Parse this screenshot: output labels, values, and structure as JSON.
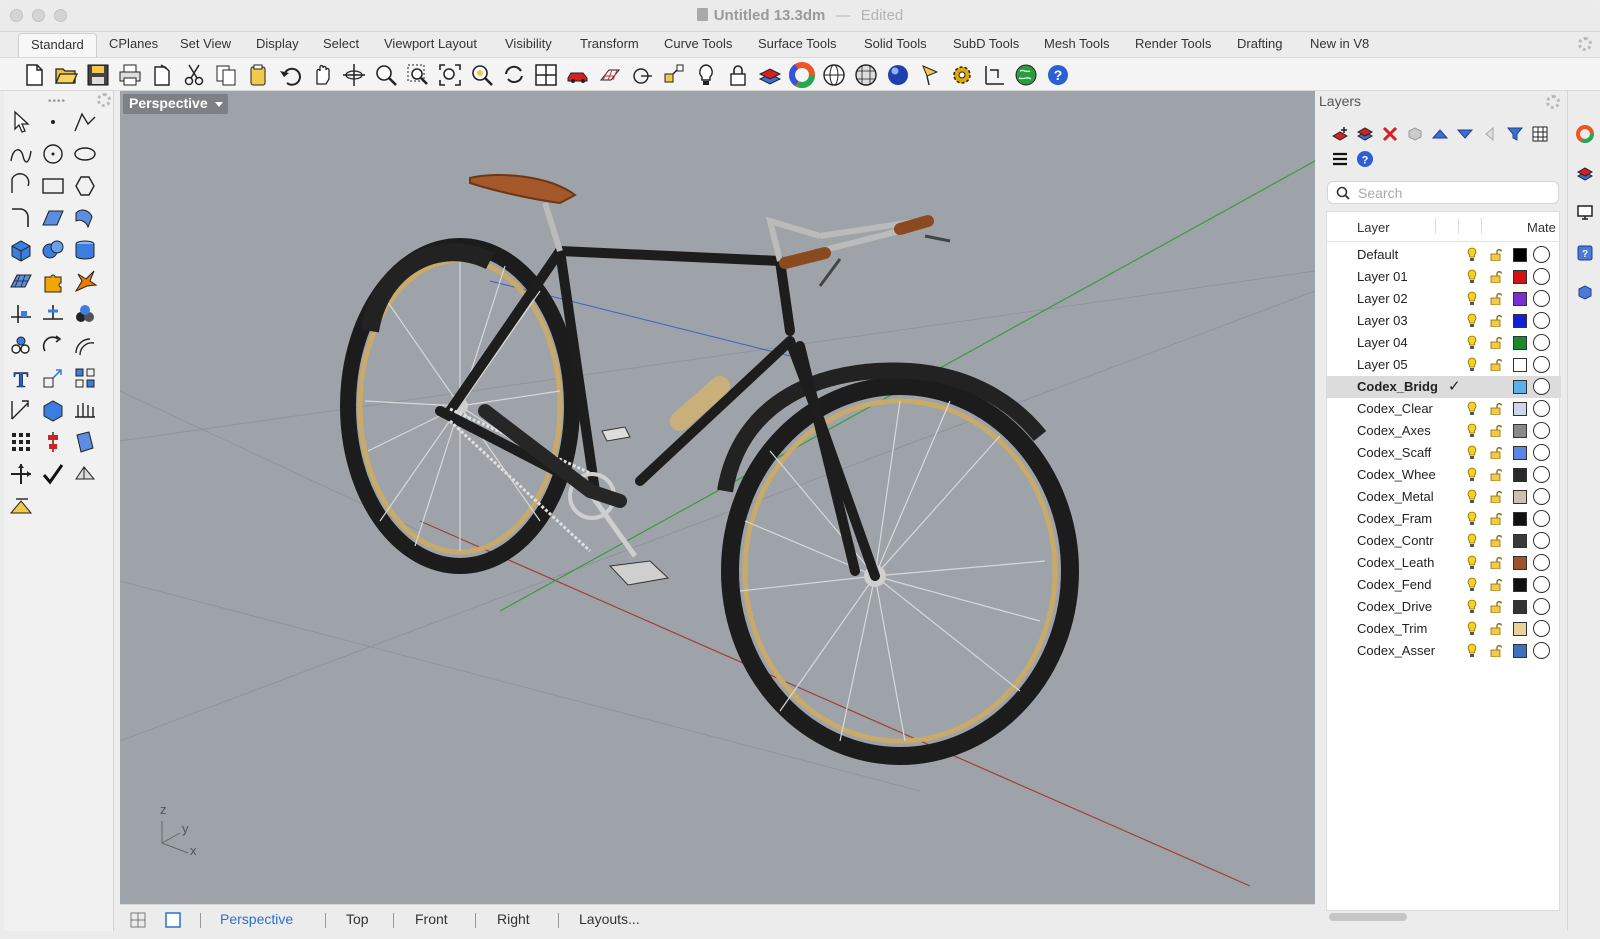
{
  "window": {
    "title": "Untitled 13.3dm",
    "separator": "—",
    "status": "Edited"
  },
  "menu_tabs": [
    "Standard",
    "CPlanes",
    "Set View",
    "Display",
    "Select",
    "Viewport Layout",
    "Visibility",
    "Transform",
    "Curve Tools",
    "Surface Tools",
    "Solid Tools",
    "SubD Tools",
    "Mesh Tools",
    "Render Tools",
    "Drafting",
    "New in V8"
  ],
  "active_menu_tab": "Standard",
  "toolbar_icons": [
    "new-file-icon",
    "open-folder-icon",
    "save-icon",
    "print-icon",
    "import-icon",
    "cut-icon",
    "copy-icon",
    "paste-icon",
    "undo-icon",
    "pan-hand-icon",
    "rotate-view-icon",
    "zoom-icon",
    "zoom-window-icon",
    "zoom-extents-icon",
    "zoom-selected-icon",
    "rotate-camera-icon",
    "four-viewports-icon",
    "car-icon",
    "grid-icon",
    "osnap-icon",
    "gumball-icon",
    "light-icon",
    "lock-icon",
    "layer-icon",
    "color-wheel-icon",
    "sphere-wireframe-icon",
    "sphere-grid-icon",
    "render-sphere-icon",
    "spotlight-icon",
    "gear-icon",
    "dimension-icon",
    "globe-icon",
    "help-icon"
  ],
  "viewport": {
    "title": "Perspective",
    "axis_labels": {
      "z": "z",
      "y": "y",
      "x": "x"
    }
  },
  "viewport_tabs": [
    "Perspective",
    "Top",
    "Front",
    "Right",
    "Layouts..."
  ],
  "active_viewport_tab": "Perspective",
  "layers_panel": {
    "title": "Layers",
    "search_placeholder": "Search",
    "columns": {
      "layer": "Layer",
      "material": "Mate"
    },
    "current_layer": "Codex_Bridg",
    "rows": [
      {
        "name": "Default",
        "color": "#000000"
      },
      {
        "name": "Layer 01",
        "color": "#d01414"
      },
      {
        "name": "Layer 02",
        "color": "#7a2fd0"
      },
      {
        "name": "Layer 03",
        "color": "#1020d8"
      },
      {
        "name": "Layer 04",
        "color": "#1a8a2a"
      },
      {
        "name": "Layer 05",
        "color": "#ffffff"
      },
      {
        "name": "Codex_Bridg",
        "color": "#5ab0ec"
      },
      {
        "name": "Codex_Clear",
        "color": "#cfd6e6"
      },
      {
        "name": "Codex_Axes",
        "color": "#8a8a8a"
      },
      {
        "name": "Codex_Scaff",
        "color": "#5a86e6"
      },
      {
        "name": "Codex_Whee",
        "color": "#2a2a2a"
      },
      {
        "name": "Codex_Metal",
        "color": "#c8c0b0"
      },
      {
        "name": "Codex_Fram",
        "color": "#111111"
      },
      {
        "name": "Codex_Contr",
        "color": "#3a3a3a"
      },
      {
        "name": "Codex_Leath",
        "color": "#a0522d"
      },
      {
        "name": "Codex_Fend",
        "color": "#111111"
      },
      {
        "name": "Codex_Drive",
        "color": "#333333"
      },
      {
        "name": "Codex_Trim",
        "color": "#e8d39a"
      },
      {
        "name": "Codex_Asser",
        "color": "#3f6fbf"
      }
    ]
  },
  "colors": {
    "viewport_bg": "#9ea3a9",
    "accent": "#2d6fd1",
    "x_axis": "#a33c3c",
    "y_axis": "#3c9a3c"
  }
}
